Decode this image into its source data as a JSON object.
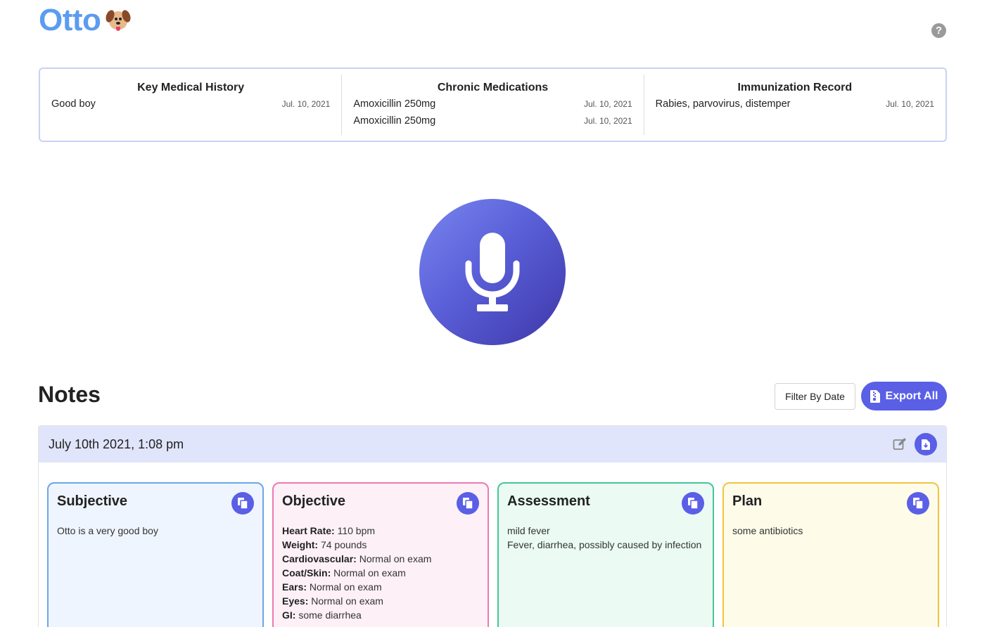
{
  "patient": {
    "name": "Otto",
    "emoji_icon": "dog-face-icon"
  },
  "help": {
    "glyph": "?"
  },
  "summary": [
    {
      "title": "Key Medical History",
      "rows": [
        {
          "text": "Good boy",
          "date": "Jul. 10, 2021"
        }
      ]
    },
    {
      "title": "Chronic Medications",
      "rows": [
        {
          "text": "Amoxicillin 250mg",
          "date": "Jul. 10, 2021"
        },
        {
          "text": "Amoxicillin 250mg",
          "date": "Jul. 10, 2021"
        }
      ]
    },
    {
      "title": "Immunization Record",
      "rows": [
        {
          "text": "Rabies, parvovirus, distemper",
          "date": "Jul. 10, 2021"
        }
      ]
    }
  ],
  "recorder": {
    "icon": "microphone-icon",
    "colors": [
      "#7a86ee",
      "#3e37a8"
    ]
  },
  "notes": {
    "title": "Notes",
    "filter_label": "Filter By Date",
    "export_label": "Export All",
    "accent": "#5a5fe6",
    "entry": {
      "date": "July 10th 2021, 1:08 pm",
      "cards": {
        "subjective": {
          "title": "Subjective",
          "text": "Otto is a very good boy"
        },
        "objective": {
          "title": "Objective",
          "lines": [
            {
              "label": "Heart Rate:",
              "value": " 110 bpm"
            },
            {
              "label": "Weight:",
              "value": " 74 pounds"
            },
            {
              "label": "Cardiovascular:",
              "value": " Normal on exam"
            },
            {
              "label": "Coat/Skin:",
              "value": " Normal on exam"
            },
            {
              "label": "Ears:",
              "value": " Normal on exam"
            },
            {
              "label": "Eyes:",
              "value": " Normal on exam"
            },
            {
              "label": "GI:",
              "value": " some diarrhea"
            }
          ]
        },
        "assessment": {
          "title": "Assessment",
          "line1": "mild fever",
          "line2": "Fever, diarrhea, possibly caused by infection"
        },
        "plan": {
          "title": "Plan",
          "text": "some antibiotics"
        }
      }
    }
  }
}
